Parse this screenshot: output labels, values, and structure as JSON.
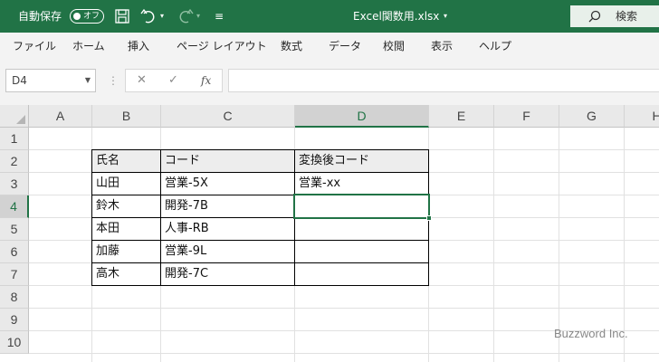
{
  "titlebar": {
    "autosave_label": "自動保存",
    "autosave_state": "オフ",
    "filename": "Excel関数用.xlsx",
    "search_label": "検索"
  },
  "ribbon": {
    "tabs": [
      "ファイル",
      "ホーム",
      "挿入",
      "ページ レイアウト",
      "数式",
      "データ",
      "校閲",
      "表示",
      "ヘルプ"
    ]
  },
  "formula_bar": {
    "name_box": "D4",
    "fx_label": "fx",
    "formula": ""
  },
  "sheet": {
    "columns": [
      "A",
      "B",
      "C",
      "D",
      "E",
      "F",
      "G",
      "H"
    ],
    "rows": [
      "1",
      "2",
      "3",
      "4",
      "5",
      "6",
      "7",
      "8",
      "9",
      "10"
    ],
    "selected_cell": "D4",
    "table": {
      "headers": [
        "氏名",
        "コード",
        "変換後コード"
      ],
      "rows": [
        [
          "山田",
          "営業-5X",
          "営業-xx"
        ],
        [
          "鈴木",
          "開発-7B",
          ""
        ],
        [
          "本田",
          "人事-RB",
          ""
        ],
        [
          "加藤",
          "営業-9L",
          ""
        ],
        [
          "高木",
          "開発-7C",
          ""
        ]
      ]
    }
  },
  "watermark": "Buzzword Inc.",
  "colors": {
    "excel_green": "#217346",
    "header_fill": "#f2f2f2"
  }
}
